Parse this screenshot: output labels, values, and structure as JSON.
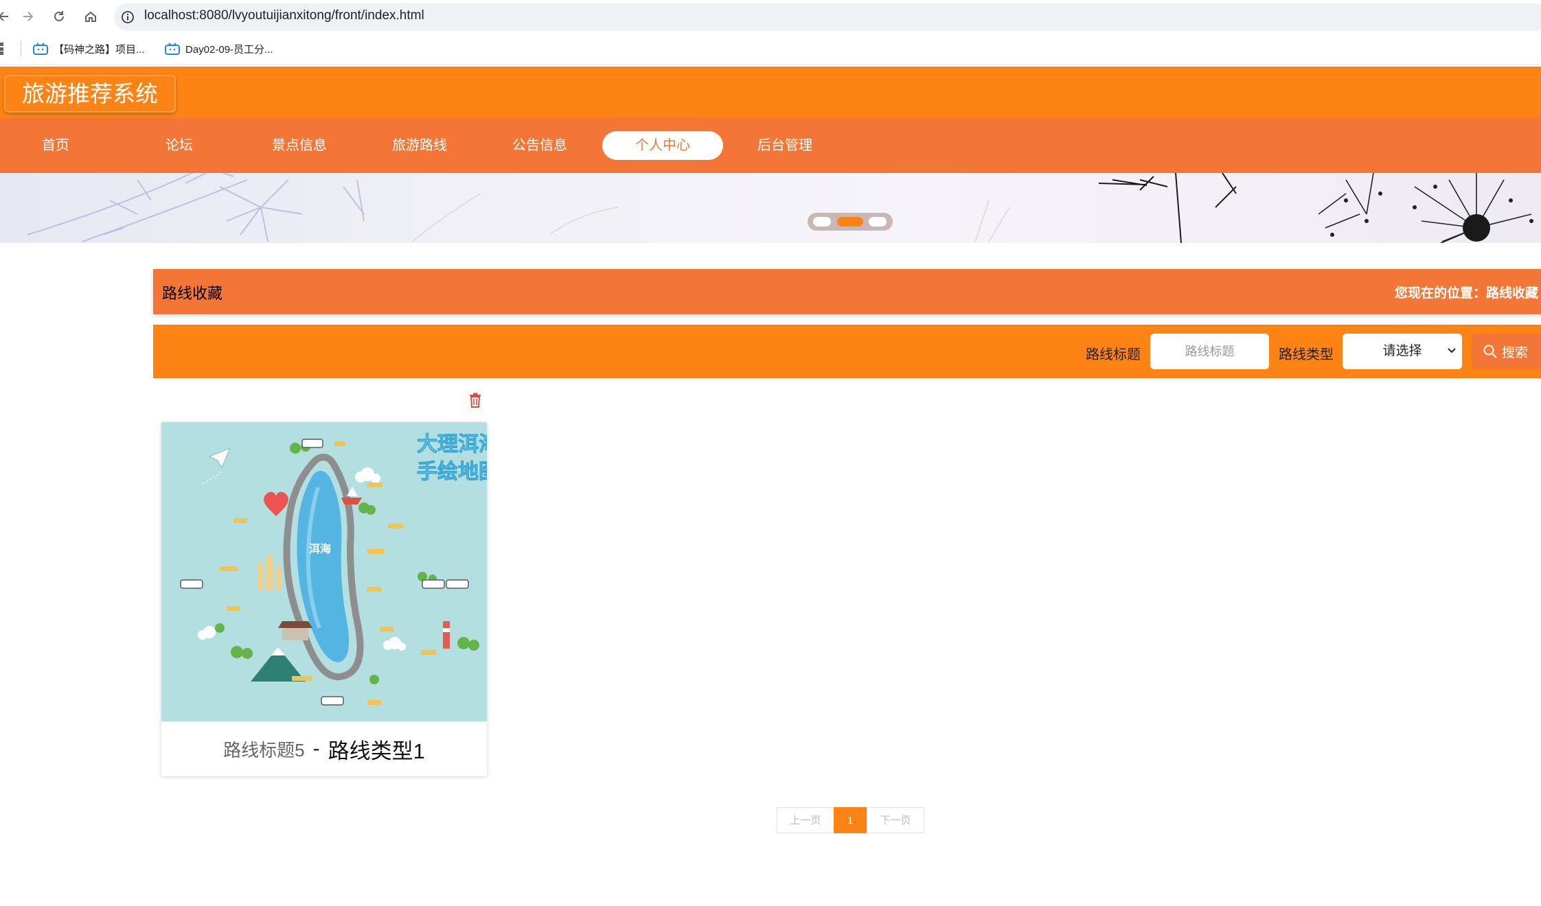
{
  "browser": {
    "url": "localhost:8080/lvyoutuijianxitong/front/index.html",
    "nav_icons": [
      "back-icon",
      "forward-icon",
      "reload-icon",
      "home-icon"
    ],
    "bookmarks": [
      {
        "label": "【码神之路】项目..."
      },
      {
        "label": "Day02-09-员工分..."
      }
    ]
  },
  "site": {
    "logo": "旅游推荐系统",
    "nav": [
      {
        "label": "首页"
      },
      {
        "label": "论坛"
      },
      {
        "label": "景点信息"
      },
      {
        "label": "旅游路线"
      },
      {
        "label": "公告信息"
      },
      {
        "label": "个人中心",
        "active": true
      },
      {
        "label": "后台管理"
      }
    ]
  },
  "banner": {
    "active_dot": 1,
    "dot_count": 3
  },
  "page": {
    "title": "路线收藏",
    "breadcrumb": "您现在的位置：路线收藏"
  },
  "search": {
    "title_label": "路线标题",
    "title_placeholder": "路线标题",
    "type_label": "路线类型",
    "type_selected": "请选择",
    "button_label": "搜索"
  },
  "items": [
    {
      "image_text_line1": "大理洱海",
      "image_text_line2": "手绘地图",
      "lake_text": "洱海",
      "title": "路线标题5",
      "separator": "-",
      "type": "路线类型1"
    }
  ],
  "pagination": {
    "prev": "上一页",
    "current": "1",
    "next": "下一页"
  },
  "colors": {
    "header": "#fc8314",
    "nav": "#f47636",
    "accent": "#fc8314",
    "delete": "#e64a3c"
  }
}
